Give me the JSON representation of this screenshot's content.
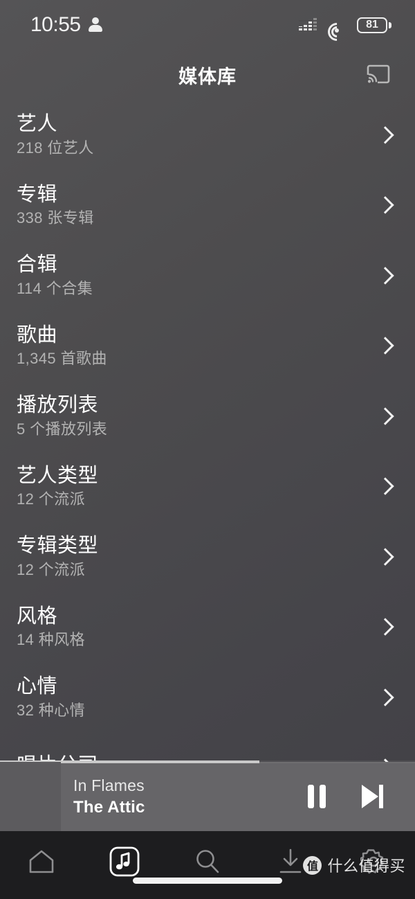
{
  "status_bar": {
    "time": "10:55",
    "profile_icon": "person-icon",
    "signal_icon": "cellular-signal-icon",
    "wifi_icon": "wifi-icon",
    "battery_level": "81"
  },
  "header": {
    "title": "媒体库",
    "cast_icon": "cast-icon"
  },
  "library": {
    "rows": [
      {
        "title": "艺人",
        "subtitle": "218 位艺人"
      },
      {
        "title": "专辑",
        "subtitle": "338 张专辑"
      },
      {
        "title": "合辑",
        "subtitle": "114 个合集"
      },
      {
        "title": "歌曲",
        "subtitle": "1,345 首歌曲"
      },
      {
        "title": "播放列表",
        "subtitle": "5 个播放列表"
      },
      {
        "title": "艺人类型",
        "subtitle": "12 个流派"
      },
      {
        "title": "专辑类型",
        "subtitle": "12 个流派"
      },
      {
        "title": "风格",
        "subtitle": "14 种风格"
      },
      {
        "title": "心情",
        "subtitle": "32 种心情"
      },
      {
        "title": "唱片公司",
        "subtitle": ""
      }
    ]
  },
  "now_playing": {
    "artist": "In Flames",
    "title": "The Attic",
    "pause_icon": "pause-icon",
    "next_icon": "next-track-icon",
    "progress_percent": "62"
  },
  "tab_bar": {
    "tabs": [
      {
        "name": "home",
        "icon": "home-icon",
        "active": false
      },
      {
        "name": "library",
        "icon": "music-note-icon",
        "active": true
      },
      {
        "name": "search",
        "icon": "search-icon",
        "active": false
      },
      {
        "name": "downloads",
        "icon": "download-icon",
        "active": false
      },
      {
        "name": "settings",
        "icon": "gear-icon",
        "active": false
      }
    ]
  },
  "watermark": {
    "logo": "值",
    "text": "什么值得买"
  },
  "colors": {
    "background": "#4d4c4e",
    "tab_bar": "#1d1d1f",
    "now_playing_bar": "#666568",
    "primary_text": "#ffffff",
    "secondary_text": "#b3b3b3"
  }
}
